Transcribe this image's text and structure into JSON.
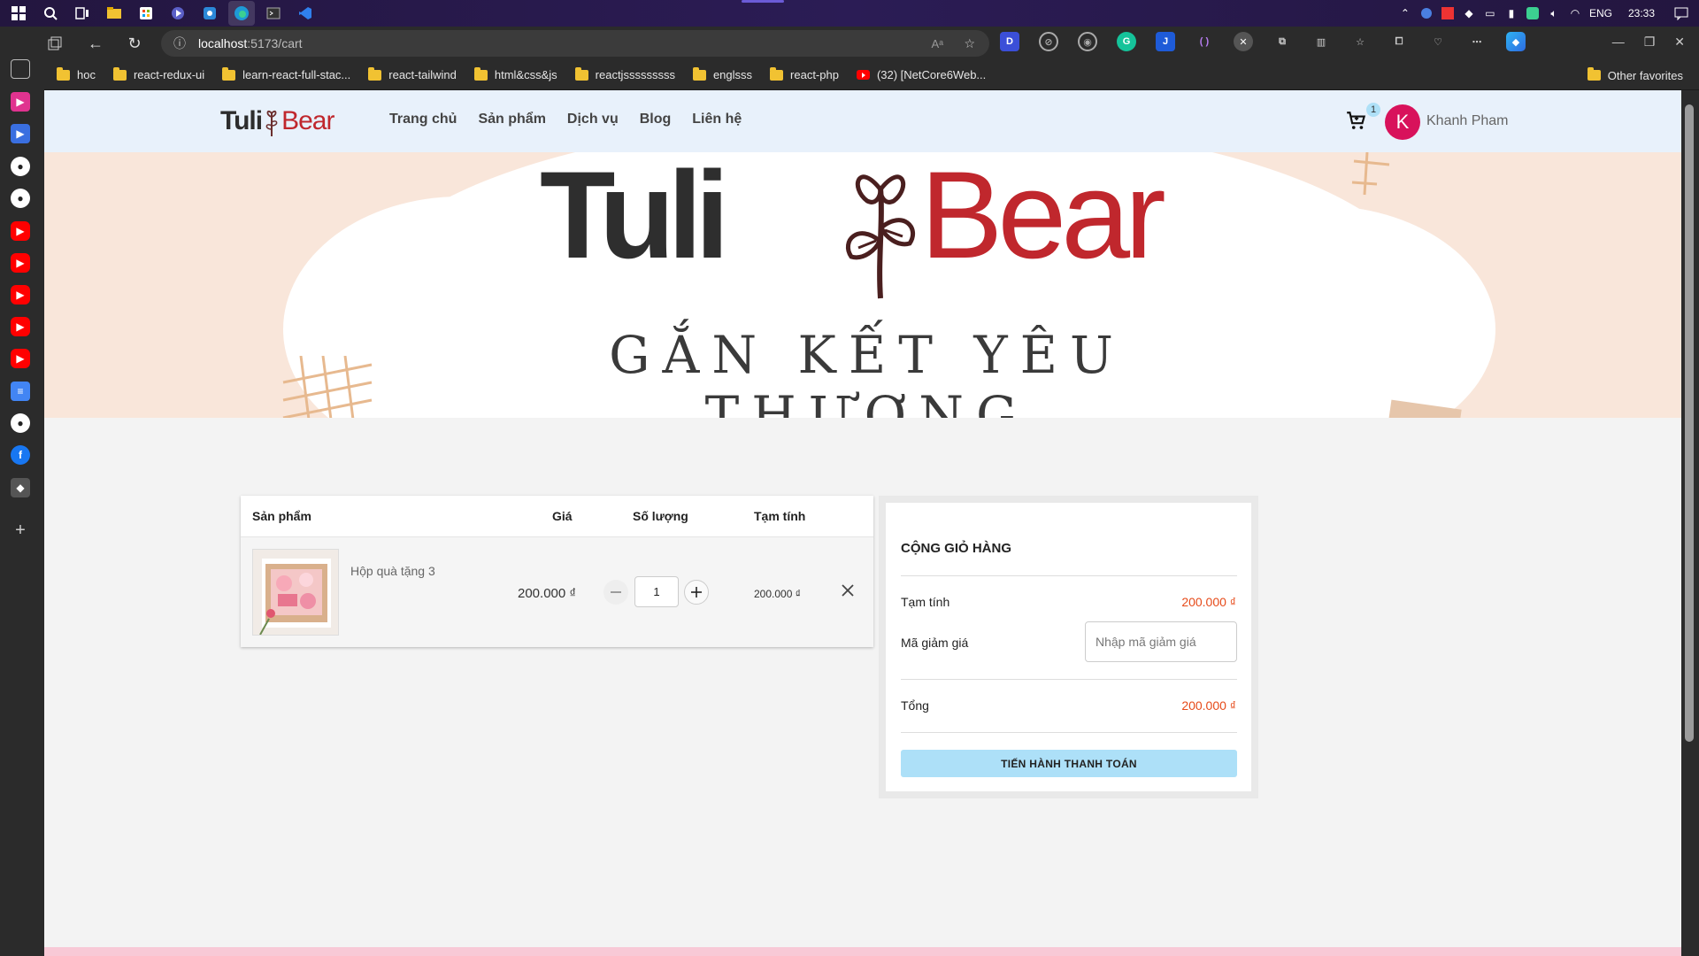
{
  "taskbar": {
    "language": "ENG",
    "time": "23:33"
  },
  "browser": {
    "address": {
      "host": "localhost",
      "path": ":5173/cart"
    },
    "bookmarks": [
      {
        "label": "hoc",
        "kind": "folder"
      },
      {
        "label": "react-redux-ui",
        "kind": "folder"
      },
      {
        "label": "learn-react-full-stac...",
        "kind": "folder"
      },
      {
        "label": "react-tailwind",
        "kind": "folder"
      },
      {
        "label": "html&css&js",
        "kind": "folder"
      },
      {
        "label": "reactjsssssssss",
        "kind": "folder"
      },
      {
        "label": "englsss",
        "kind": "folder"
      },
      {
        "label": "react-php",
        "kind": "folder"
      },
      {
        "label": "(32) [NetCore6Web...",
        "kind": "youtube"
      }
    ],
    "other_favorites": "Other favorites"
  },
  "site": {
    "logo": {
      "part1": "Tuli",
      "part2": "Bear"
    },
    "nav": [
      "Trang chủ",
      "Sản phẩm",
      "Dịch vụ",
      "Blog",
      "Liên hệ"
    ],
    "cart_count": "1",
    "user": {
      "initial": "K",
      "name": "Khanh Pham"
    },
    "banner": {
      "logo_part1": "Tuli",
      "logo_part2": "Bear",
      "slogan": "GẮN KẾT YÊU THƯƠNG"
    }
  },
  "cart": {
    "headers": {
      "product": "Sản phẩm",
      "price": "Giá",
      "quantity": "Số lượng",
      "subtotal": "Tạm tính"
    },
    "items": [
      {
        "name": "Hộp quà tặng 3",
        "price": "200.000 ₫",
        "quantity": "1",
        "subtotal": "200.000 ₫"
      }
    ]
  },
  "summary": {
    "title": "CỘNG GIỎ HÀNG",
    "subtotal_label": "Tạm tính",
    "subtotal_value": "200.000 ₫",
    "coupon_label": "Mã giảm giá",
    "coupon_placeholder": "Nhập mã giảm giá",
    "total_label": "Tổng",
    "total_value": "200.000 ₫",
    "checkout_label": "TIẾN HÀNH THANH TOÁN"
  },
  "colors": {
    "header_bg": "#e8f1fb",
    "banner_bg": "#f9e6da",
    "accent_red": "#c0272d",
    "price_orange": "#e64a19",
    "checkout_bg": "#ade0f8",
    "avatar_bg": "#d8125b"
  }
}
